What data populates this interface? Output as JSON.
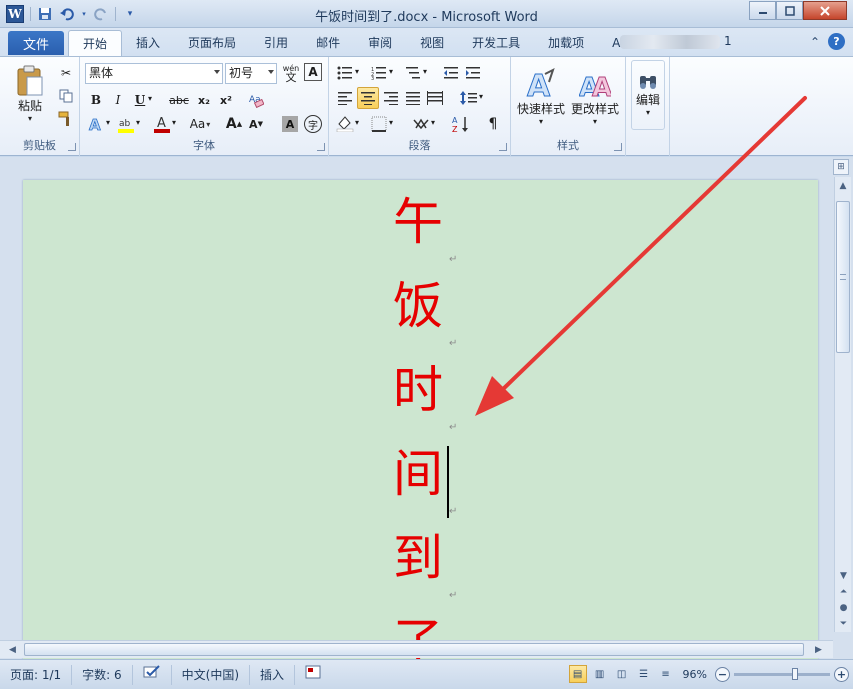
{
  "window": {
    "title": "午饭时间到了.docx - Microsoft Word",
    "minimize_icon": "minimize-icon",
    "maximize_icon": "maximize-icon",
    "close_icon": "close-icon"
  },
  "qat": {
    "app_icon": "W",
    "items": [
      "save-icon",
      "undo-icon",
      "redo-icon",
      "customize-qat-icon"
    ]
  },
  "tabs": {
    "file": "文件",
    "items": [
      "开始",
      "插入",
      "页面布局",
      "引用",
      "邮件",
      "审阅",
      "视图",
      "开发工具",
      "加载项",
      "A"
    ],
    "active": "开始",
    "trailing": "1"
  },
  "ribbon": {
    "clipboard": {
      "label": "剪贴板",
      "paste_label": "粘贴"
    },
    "font": {
      "label": "字体",
      "font_name": "黑体",
      "font_size": "初号",
      "bold": "B",
      "italic": "I",
      "underline": "U",
      "strike": "abc",
      "subscript": "x₂",
      "superscript": "x²",
      "grow": "A",
      "shrink": "A",
      "case": "Aa",
      "pinyin": "wén",
      "border_char": "A",
      "font_color": "#c00000",
      "highlight_color": "#ffff00"
    },
    "paragraph": {
      "label": "段落"
    },
    "styles": {
      "label": "样式",
      "quick_styles": "快速样式",
      "change_styles": "更改样式"
    },
    "editing": {
      "label": "编辑"
    }
  },
  "document": {
    "background": "#cde6d0",
    "text_color": "#e60000",
    "chars": [
      "午",
      "饭",
      "时",
      "间",
      "到",
      "了"
    ],
    "paragraph_mark": "↵"
  },
  "annotation": {
    "arrow_color": "#e53935"
  },
  "status": {
    "page": "页面: 1/1",
    "words": "字数: 6",
    "language": "中文(中国)",
    "mode": "插入",
    "zoom": "96%"
  }
}
